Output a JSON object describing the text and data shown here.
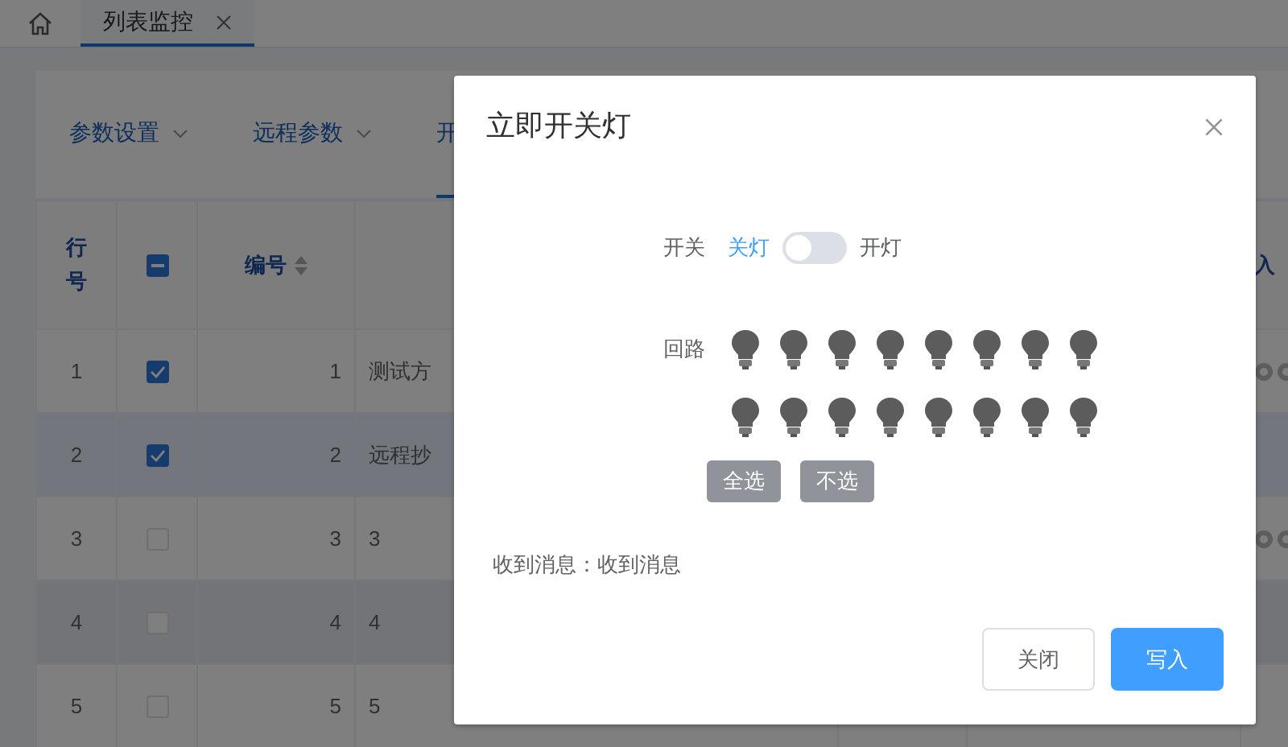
{
  "tabbar": {
    "tabs": [
      {
        "label": "列表监控",
        "selected": true,
        "closable": true
      }
    ]
  },
  "subtabs": [
    {
      "label": "参数设置",
      "dropdown": true,
      "selected": false
    },
    {
      "label": "远程参数",
      "dropdown": true,
      "selected": false
    },
    {
      "label": "开",
      "selected": true
    }
  ],
  "table": {
    "header": {
      "row_no": "行号",
      "select_all_indeterminate": true,
      "number": "编号",
      "sortable": true,
      "column_6": "入"
    },
    "rows": [
      {
        "row_no": "1",
        "checked": true,
        "number": "1",
        "name": "测试方",
        "actions": true
      },
      {
        "row_no": "2",
        "checked": true,
        "number": "2",
        "name": "远程抄",
        "actions": false
      },
      {
        "row_no": "3",
        "checked": false,
        "number": "3",
        "name": "3",
        "actions": true
      },
      {
        "row_no": "4",
        "checked": false,
        "number": "4",
        "name": "4",
        "actions": false
      },
      {
        "row_no": "5",
        "checked": false,
        "number": "5",
        "name": "5",
        "actions": false
      }
    ]
  },
  "dialog": {
    "title": "立即开关灯",
    "switch": {
      "label": "开关",
      "off_text": "关灯",
      "on_text": "开灯",
      "on": false
    },
    "circuits": {
      "label": "回路",
      "lights": [
        {
          "on": false
        },
        {
          "on": false
        },
        {
          "on": false
        },
        {
          "on": false
        },
        {
          "on": false
        },
        {
          "on": false
        },
        {
          "on": false
        },
        {
          "on": false
        },
        {
          "on": false
        },
        {
          "on": false
        },
        {
          "on": false
        },
        {
          "on": false
        },
        {
          "on": false
        },
        {
          "on": false
        },
        {
          "on": false
        },
        {
          "on": false
        }
      ],
      "buttons": [
        "全选",
        "不选"
      ]
    },
    "message": "收到消息：收到消息",
    "footer_buttons": [
      {
        "label": "关闭",
        "kind": "default"
      },
      {
        "label": "写入",
        "kind": "primary"
      }
    ]
  }
}
